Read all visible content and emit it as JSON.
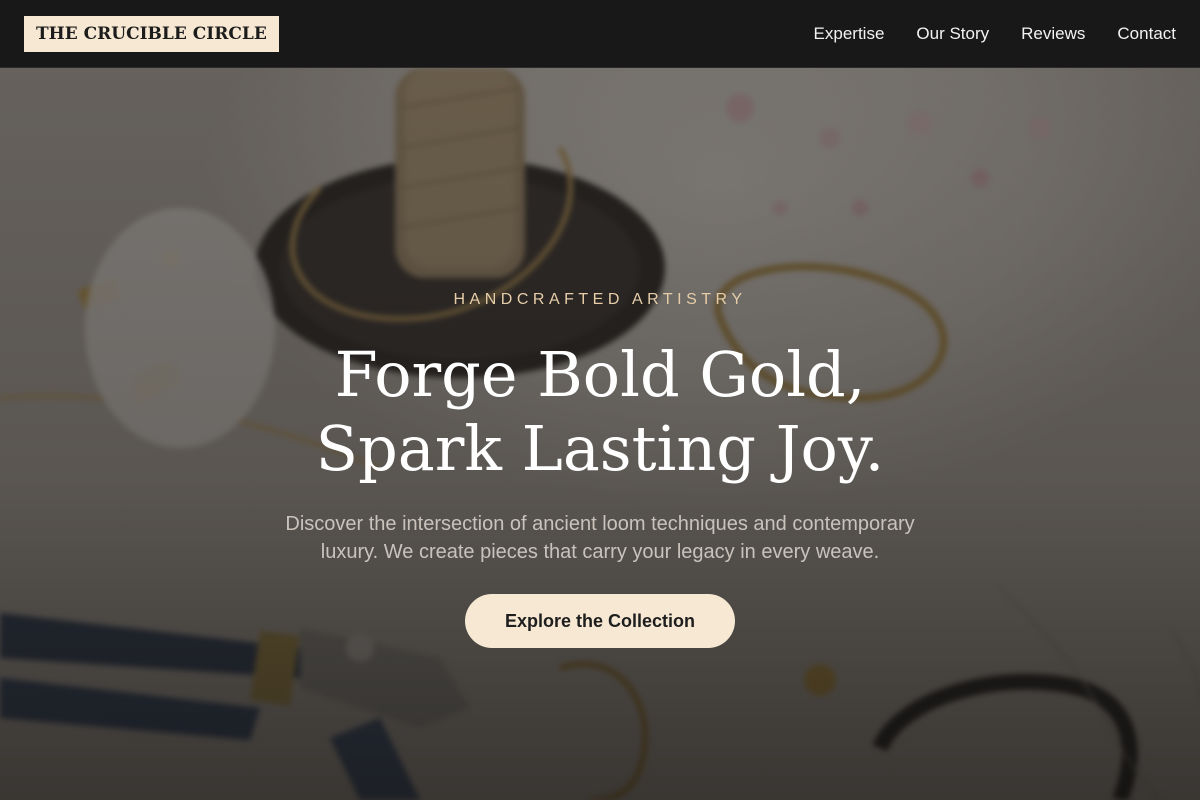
{
  "brand": {
    "logo_text": "THE CRUCIBLE CIRCLE",
    "accent_color": "#f6e8d3",
    "nav_background": "#181818"
  },
  "nav": {
    "links": [
      {
        "label": "Expertise"
      },
      {
        "label": "Our Story"
      },
      {
        "label": "Reviews"
      },
      {
        "label": "Contact"
      }
    ]
  },
  "hero": {
    "eyebrow": "HANDCRAFTED ARTISTRY",
    "headline_line1": "Forge Bold Gold,",
    "headline_line2": "Spark Lasting Joy.",
    "subtext": "Discover the intersection of ancient loom techniques and contemporary luxury. We create pieces that carry your legacy in every weave.",
    "cta_label": "Explore the Collection"
  }
}
